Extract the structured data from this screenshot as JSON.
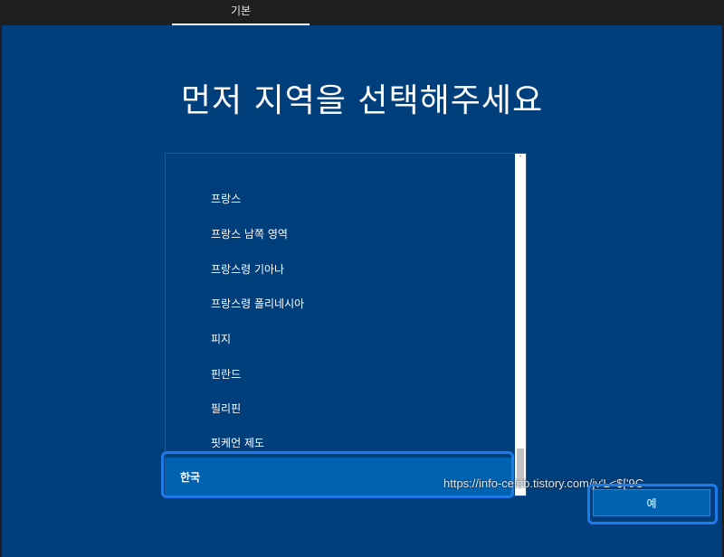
{
  "tab": {
    "label": "기본"
  },
  "title": "먼저 지역을 선택해주세요",
  "region_list": {
    "items": [
      {
        "label": "프랑스",
        "selected": false
      },
      {
        "label": "프랑스 남쪽 영역",
        "selected": false
      },
      {
        "label": "프랑스령 기아나",
        "selected": false
      },
      {
        "label": "프랑스령 폴리네시아",
        "selected": false
      },
      {
        "label": "피지",
        "selected": false
      },
      {
        "label": "핀란드",
        "selected": false
      },
      {
        "label": "필리핀",
        "selected": false
      },
      {
        "label": "핏케언 제도",
        "selected": false
      },
      {
        "label": "한국",
        "selected": true
      }
    ]
  },
  "scrollbar": {
    "up_glyph": "˄",
    "down_glyph": "˅"
  },
  "watermark": "https://info-celeb.tistory.com/jv'L<$['9C",
  "actions": {
    "yes_label": "예"
  },
  "colors": {
    "background": "#003f7c",
    "selected": "#0063b1",
    "focus": "#1d7ae8"
  }
}
